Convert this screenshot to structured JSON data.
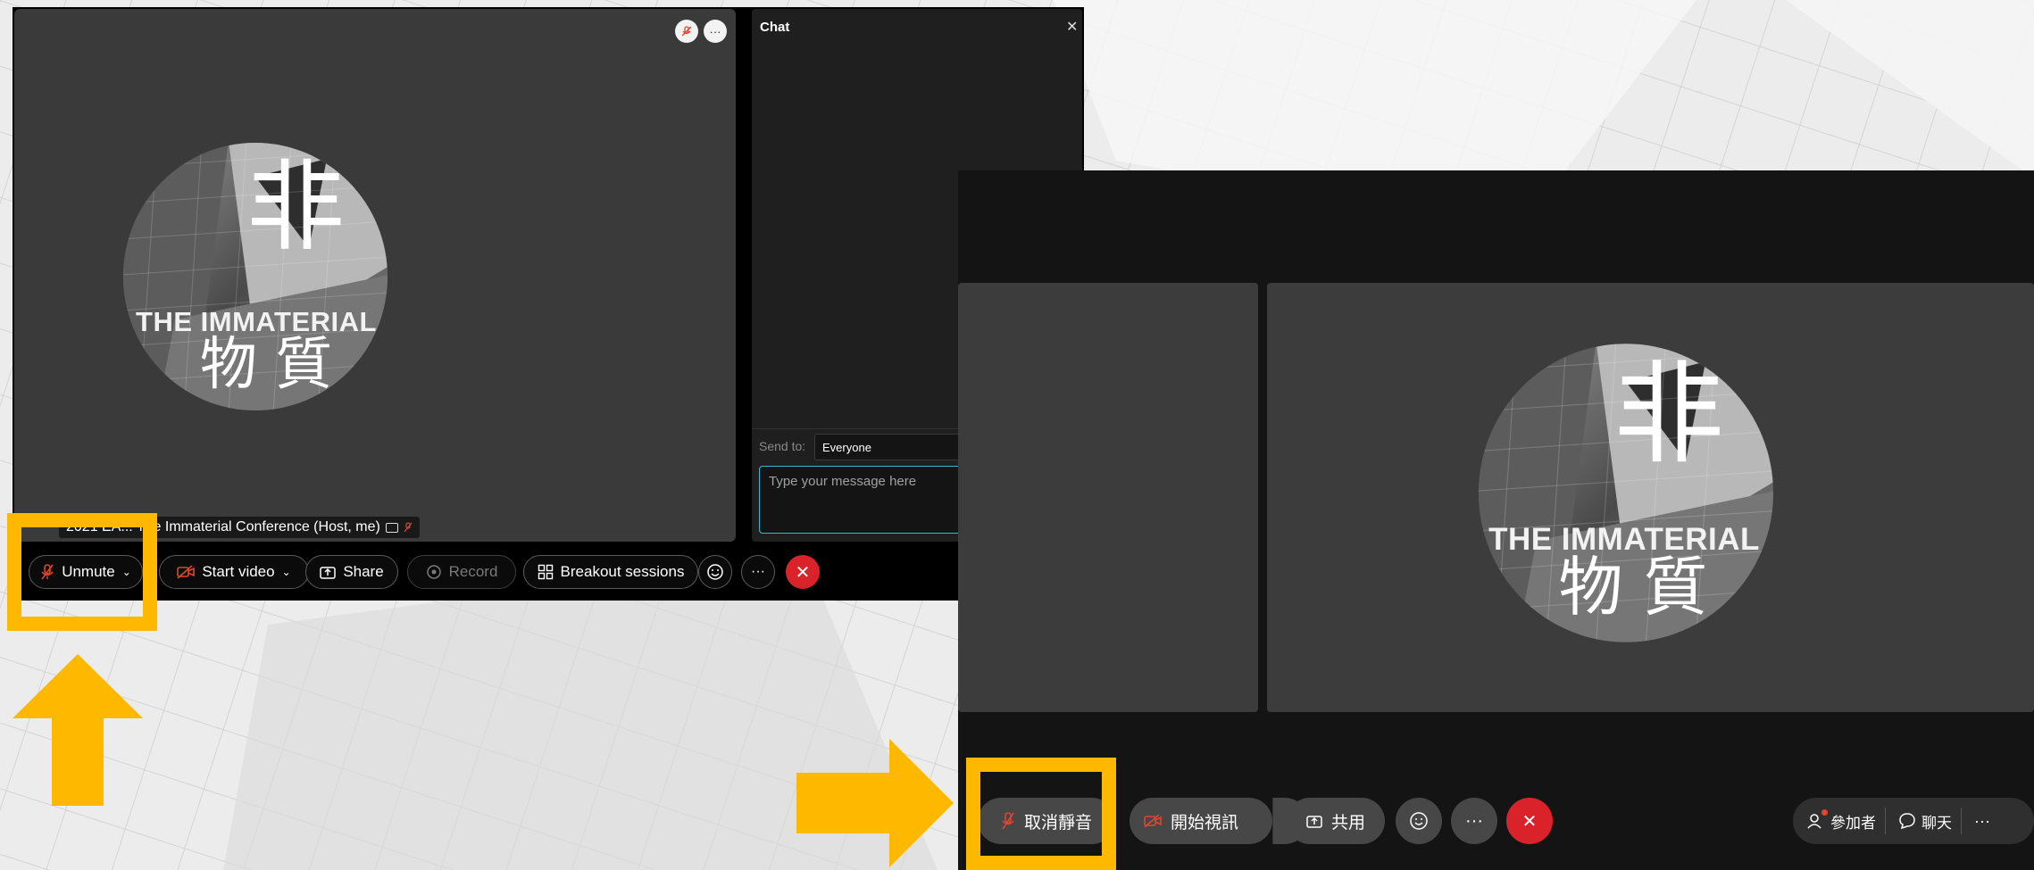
{
  "colors": {
    "highlight": "#ffb800",
    "end_call": "#d9222a",
    "accent_input": "#37b8d8"
  },
  "logo": {
    "main_char": "非",
    "banner": "THE IMMATERIAL",
    "sub_chars": "物 質"
  },
  "left_window": {
    "chat": {
      "title": "Chat",
      "close_icon": "close-icon",
      "send_to_label": "Send to:",
      "send_to_value": "Everyone",
      "message_placeholder": "Type your message here"
    },
    "participant_label": "2021 EA... The Immaterial Conference (Host, me)",
    "toolbar": {
      "unmute": "Unmute",
      "start_video": "Start video",
      "share": "Share",
      "record": "Record",
      "breakout": "Breakout sessions",
      "more": "···"
    }
  },
  "right_window": {
    "toolbar": {
      "unmute": "取消靜音",
      "start_video": "開始視訊",
      "share": "共用",
      "more": "···",
      "participants": "參加者",
      "chat": "聊天",
      "overflow": "···"
    }
  }
}
